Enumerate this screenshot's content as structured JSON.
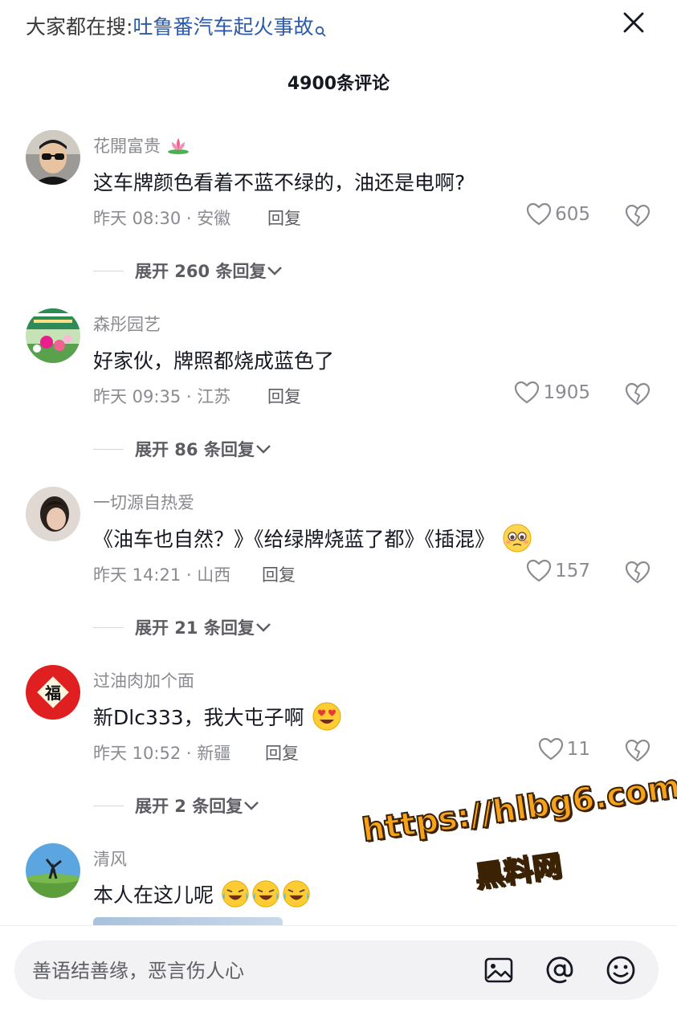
{
  "header": {
    "search_prefix": "大家都在搜:",
    "search_term": "吐鲁番汽车起火事故",
    "comment_count": "4900条评论"
  },
  "comments": [
    {
      "username": "花開富贵",
      "text": "这车牌颜色看着不蓝不绿的，油还是电啊?",
      "time_location": "昨天 08:30 · 安徽",
      "reply": "回复",
      "likes": "605",
      "expand": "展开 260 条回复"
    },
    {
      "username": "森彤园艺",
      "text": "好家伙，牌照都烧成蓝色了",
      "time_location": "昨天 09:35 · 江苏",
      "reply": "回复",
      "likes": "1905",
      "expand": "展开 86 条回复"
    },
    {
      "username": "一切源自热爱",
      "text": "《油车也自然？》《给绿牌烧蓝了都》《插混》",
      "time_location": "昨天 14:21 · 山西",
      "reply": "回复",
      "likes": "157",
      "expand": "展开 21 条回复"
    },
    {
      "username": "过油肉加个面",
      "text": "新Dlc333，我大屯子啊",
      "time_location": "昨天 10:52 · 新疆",
      "reply": "回复",
      "likes": "11",
      "expand": "展开 2 条回复"
    },
    {
      "username": "清风",
      "text": "本人在这儿呢"
    }
  ],
  "avatar_text": {
    "fu": "福"
  },
  "watermark": {
    "url": "https://hlbg6.com",
    "name": "黑料网"
  },
  "input": {
    "placeholder": "善语结善缘，恶言伤人心"
  },
  "colors": {
    "search_term": "#2c5aa8",
    "secondary_text": "#8a8b91",
    "primary_text": "#161823",
    "watermark": "#f7a21b"
  }
}
